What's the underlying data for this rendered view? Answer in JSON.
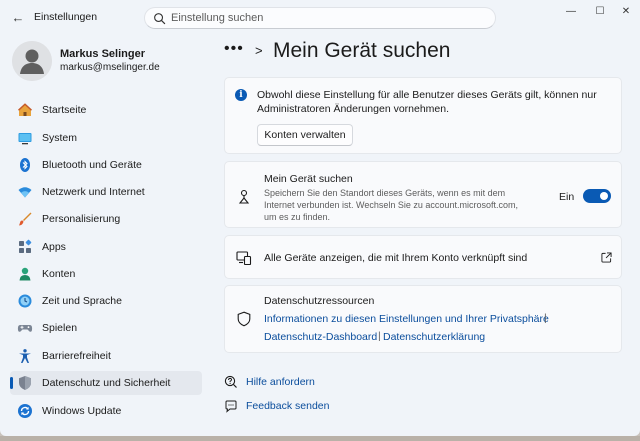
{
  "window": {
    "title": "Einstellungen",
    "controls": {
      "minimize": "—",
      "maximize": "☐",
      "close": "✕"
    }
  },
  "search": {
    "placeholder": "Einstellung suchen",
    "value": ""
  },
  "profile": {
    "name": "Markus Selinger",
    "email": "markus@mselinger.de"
  },
  "sidebar": {
    "items": [
      {
        "label": "Startseite",
        "icon": "home-icon"
      },
      {
        "label": "System",
        "icon": "system-icon"
      },
      {
        "label": "Bluetooth und Geräte",
        "icon": "bluetooth-icon"
      },
      {
        "label": "Netzwerk und Internet",
        "icon": "network-icon"
      },
      {
        "label": "Personalisierung",
        "icon": "brush-icon"
      },
      {
        "label": "Apps",
        "icon": "apps-icon"
      },
      {
        "label": "Konten",
        "icon": "accounts-icon"
      },
      {
        "label": "Zeit und Sprache",
        "icon": "time-language-icon"
      },
      {
        "label": "Spielen",
        "icon": "gaming-icon"
      },
      {
        "label": "Barrierefreiheit",
        "icon": "accessibility-icon"
      },
      {
        "label": "Datenschutz und Sicherheit",
        "icon": "shield-icon",
        "selected": true
      },
      {
        "label": "Windows Update",
        "icon": "windows-update-icon"
      }
    ]
  },
  "header": {
    "breadcrumb_more": "•••",
    "separator": ">",
    "title": "Mein Gerät suchen"
  },
  "info_card": {
    "text": "Obwohl diese Einstellung für alle Benutzer dieses Geräts gilt, können nur Administratoren Änderungen vornehmen.",
    "button_label": "Konten verwalten"
  },
  "find_device": {
    "title": "Mein Gerät suchen",
    "description": "Speichern Sie den Standort dieses Geräts, wenn es mit dem Internet verbunden ist. Wechseln Sie zu account.microsoft.com, um es zu finden.",
    "toggle_label": "Ein",
    "toggle_on": true
  },
  "devices_link": {
    "label": "Alle Geräte anzeigen, die mit Ihrem Konto verknüpft sind"
  },
  "privacy_resources": {
    "title": "Datenschutzressourcen",
    "links": [
      "Informationen zu diesen Einstellungen und Ihrer Privatsphäre",
      "Datenschutz-Dashboard",
      "Datenschutzerklärung"
    ],
    "separator": "|"
  },
  "help": {
    "get_help": "Hilfe anfordern",
    "feedback": "Feedback senden"
  },
  "colors": {
    "accent": "#0a5ab4",
    "link": "#0a4d9c",
    "background": "#f0f4f9",
    "card": "#f9fafc"
  }
}
